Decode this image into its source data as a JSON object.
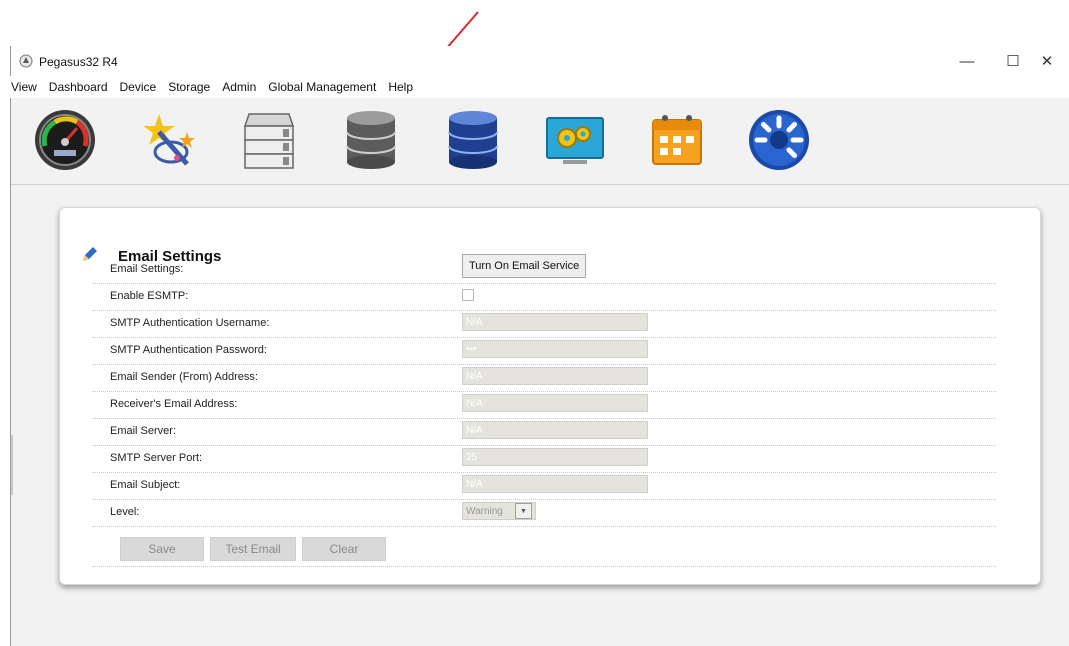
{
  "window": {
    "title": "Pegasus32 R4",
    "controls": {
      "minimize": "—",
      "maximize": "☐",
      "close": "✕"
    }
  },
  "menu": [
    "View",
    "Dashboard",
    "Device",
    "Storage",
    "Admin",
    "Global Management",
    "Help"
  ],
  "toolbar": [
    "gauge-icon",
    "wizard-icon",
    "drive-bays-icon",
    "storage-pool-icon",
    "volume-icon",
    "settings-gears-icon",
    "calendar-icon",
    "progress-spinner-icon"
  ],
  "form": {
    "title": "Email Settings",
    "rows": [
      {
        "label": "Email Settings:",
        "button": "Turn On Email Service"
      },
      {
        "label": "Enable ESMTP:"
      },
      {
        "label": "SMTP Authentication Username:",
        "value": "N/A"
      },
      {
        "label": "SMTP Authentication Password:",
        "value": "•••"
      },
      {
        "label": "Email Sender (From) Address:",
        "value": "N/A"
      },
      {
        "label": "Receiver's Email Address:",
        "value": "N/A"
      },
      {
        "label": "Email Server:",
        "value": "N/A"
      },
      {
        "label": "SMTP Server Port:",
        "value": "25"
      },
      {
        "label": "Email Subject:",
        "value": "N/A"
      },
      {
        "label": "Level:",
        "selected": "Warning"
      }
    ],
    "actions": {
      "save": "Save",
      "test": "Test Email",
      "clear": "Clear"
    }
  },
  "colors": {
    "annotation_arrow": "#d42a2a",
    "disabled_field": "#e4e4dd",
    "card_bg": "#ffffff"
  }
}
